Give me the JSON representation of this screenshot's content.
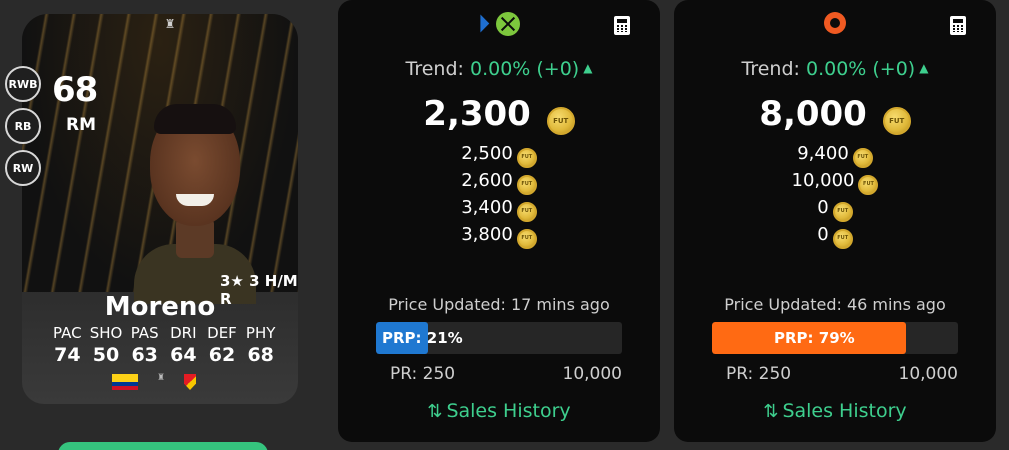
{
  "card": {
    "rating": "68",
    "position": "RM",
    "alt_positions": [
      "RWB",
      "RB",
      "RW"
    ],
    "skills": "3★ 3 H/M R",
    "name": "Moreno",
    "league_logo_text": "CONMEBOL LIBERTADORES",
    "stats": [
      {
        "label": "PAC",
        "value": "74"
      },
      {
        "label": "SHO",
        "value": "50"
      },
      {
        "label": "PAS",
        "value": "63"
      },
      {
        "label": "DRI",
        "value": "64"
      },
      {
        "label": "DEF",
        "value": "62"
      },
      {
        "label": "PHY",
        "value": "68"
      }
    ]
  },
  "panels": [
    {
      "platform": "playstation-xbox",
      "trend_label": "Trend: ",
      "trend_value": "0.00% (+0)",
      "main_price": "2,300",
      "prices": [
        "2,500",
        "2,600",
        "3,400",
        "3,800"
      ],
      "updated": "Price Updated: 17 mins ago",
      "prp_label": "PRP: 21%",
      "prp_percent": 21,
      "prp_color": "#1f78d1",
      "pr_min": "PR: 250",
      "pr_max": "10,000",
      "sales_history": "Sales History"
    },
    {
      "platform": "origin-pc",
      "trend_label": "Trend: ",
      "trend_value": "0.00% (+0)",
      "main_price": "8,000",
      "prices": [
        "9,400",
        "10,000",
        "0",
        "0"
      ],
      "updated": "Price Updated: 46 mins ago",
      "prp_label": "PRP: 79%",
      "prp_percent": 79,
      "prp_color": "#ff6a13",
      "pr_min": "PR: 250",
      "pr_max": "10,000",
      "sales_history": "Sales History"
    }
  ],
  "coin_text": "FUT",
  "colors": {
    "accent_green": "#3ecf8e",
    "coin_gold": "#e0b93a",
    "panel_bg": "#0b0b0b"
  }
}
